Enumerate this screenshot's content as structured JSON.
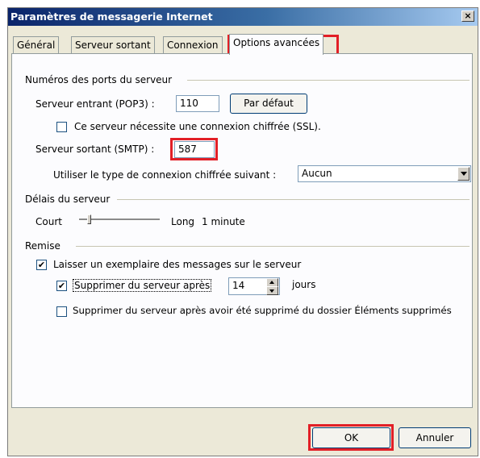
{
  "window": {
    "title": "Paramètres de messagerie Internet",
    "close_glyph": "×"
  },
  "tabs": [
    {
      "label": "Général"
    },
    {
      "label": "Serveur sortant"
    },
    {
      "label": "Connexion"
    },
    {
      "label": "Options avancées"
    }
  ],
  "ports": {
    "section_title": "Numéros des ports du serveur",
    "incoming_label": "Serveur entrant (POP3) :",
    "incoming_value": "110",
    "default_button": "Par défaut",
    "ssl_label": "Ce serveur nécessite une connexion chiffrée (SSL).",
    "ssl_checked": false,
    "outgoing_label": "Serveur sortant (SMTP) :",
    "outgoing_value": "587",
    "encryption_label": "Utiliser le type de connexion chiffrée suivant :",
    "encryption_value": "Aucun"
  },
  "timeouts": {
    "section_title": "Délais du serveur",
    "short_label": "Court",
    "long_label": "Long",
    "value_text": "1 minute"
  },
  "delivery": {
    "section_title": "Remise",
    "leave_copy_label": "Laisser un exemplaire des messages sur le serveur",
    "leave_copy_checked": true,
    "remove_after_label": "Supprimer du serveur après",
    "remove_after_checked": true,
    "days_value": "14",
    "days_unit": "jours",
    "remove_deleted_label": "Supprimer du serveur après avoir été supprimé du dossier Éléments supprimés",
    "remove_deleted_checked": false
  },
  "footer": {
    "ok_label": "OK",
    "cancel_label": "Annuler"
  },
  "colors": {
    "highlight": "#e21f26",
    "title_bar": "#0a246a"
  }
}
